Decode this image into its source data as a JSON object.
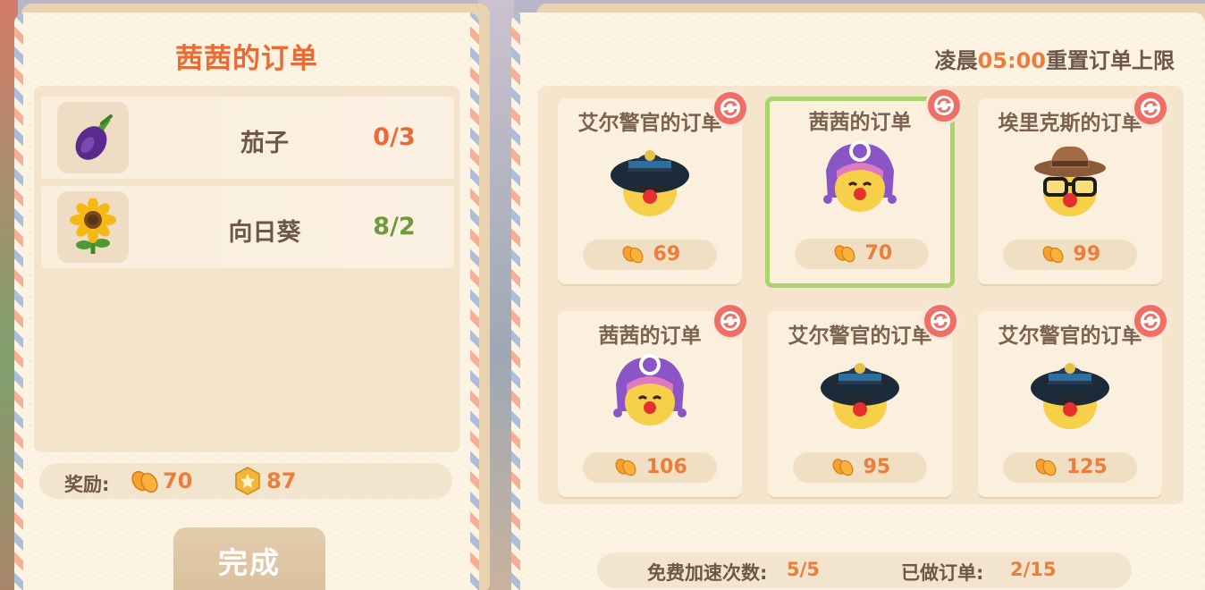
{
  "order_panel": {
    "title": "茜茜的订单",
    "items": [
      {
        "name": "茄子",
        "count": "0/3",
        "icon": "eggplant-icon",
        "count_color": "#ec6a31"
      },
      {
        "name": "向日葵",
        "count": "8/2",
        "icon": "sunflower-icon",
        "count_color": "#6f9a3a"
      }
    ],
    "reward_label": "奖励:",
    "reward_coins": "70",
    "reward_stars": "87",
    "complete_label": "完成"
  },
  "board": {
    "reset_prefix": "凌晨",
    "reset_time": "05:00",
    "reset_suffix": "重置订单上限",
    "orders": [
      {
        "title": "艾尔警官的订单",
        "reward": "69",
        "character": "police-officer",
        "selected": false
      },
      {
        "title": "茜茜的订单",
        "reward": "70",
        "character": "purple-jester",
        "selected": true
      },
      {
        "title": "埃里克斯的订单",
        "reward": "99",
        "character": "glasses-hat",
        "selected": false
      },
      {
        "title": "茜茜的订单",
        "reward": "106",
        "character": "purple-jester",
        "selected": false
      },
      {
        "title": "艾尔警官的订单",
        "reward": "95",
        "character": "police-officer",
        "selected": false
      },
      {
        "title": "艾尔警官的订单",
        "reward": "125",
        "character": "police-officer",
        "selected": false
      }
    ],
    "free_speedup_label": "免费加速次数:",
    "free_speedup_value": "5/5",
    "done_orders_label": "已做订单:",
    "done_orders_value": "2/15"
  },
  "colors": {
    "accent_orange": "#ec7d3a",
    "title_orange": "#ec6a31",
    "selected_green": "#a9d46e",
    "refresh_red": "#ee6f66"
  }
}
